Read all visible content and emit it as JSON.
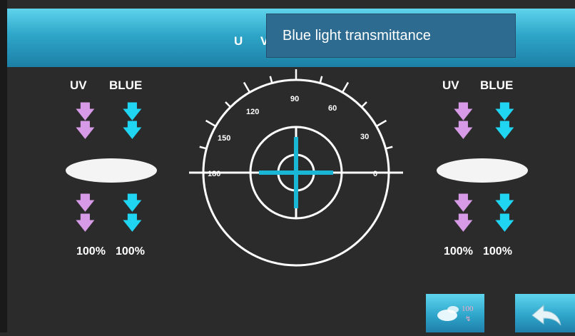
{
  "header": {
    "title": "U V",
    "overlay_title": "Blue light transmittance"
  },
  "left_panel": {
    "uv_label": "UV",
    "blue_label": "BLUE",
    "uv_percent": "100%",
    "blue_percent": "100%"
  },
  "right_panel": {
    "uv_label": "UV",
    "blue_label": "BLUE",
    "uv_percent": "100%",
    "blue_percent": "100%"
  },
  "protractor": {
    "labels": [
      "0",
      "30",
      "60",
      "90",
      "120",
      "150",
      "180"
    ]
  },
  "buttons": {
    "reset_badge": "100"
  },
  "colors": {
    "header": "#2ea6c8",
    "uv_arrow": "#d79ae6",
    "blue_arrow": "#1fd5f2",
    "crosshair": "#19b6d6",
    "background": "#2b2b2b",
    "title_box": "#2d6b91"
  }
}
